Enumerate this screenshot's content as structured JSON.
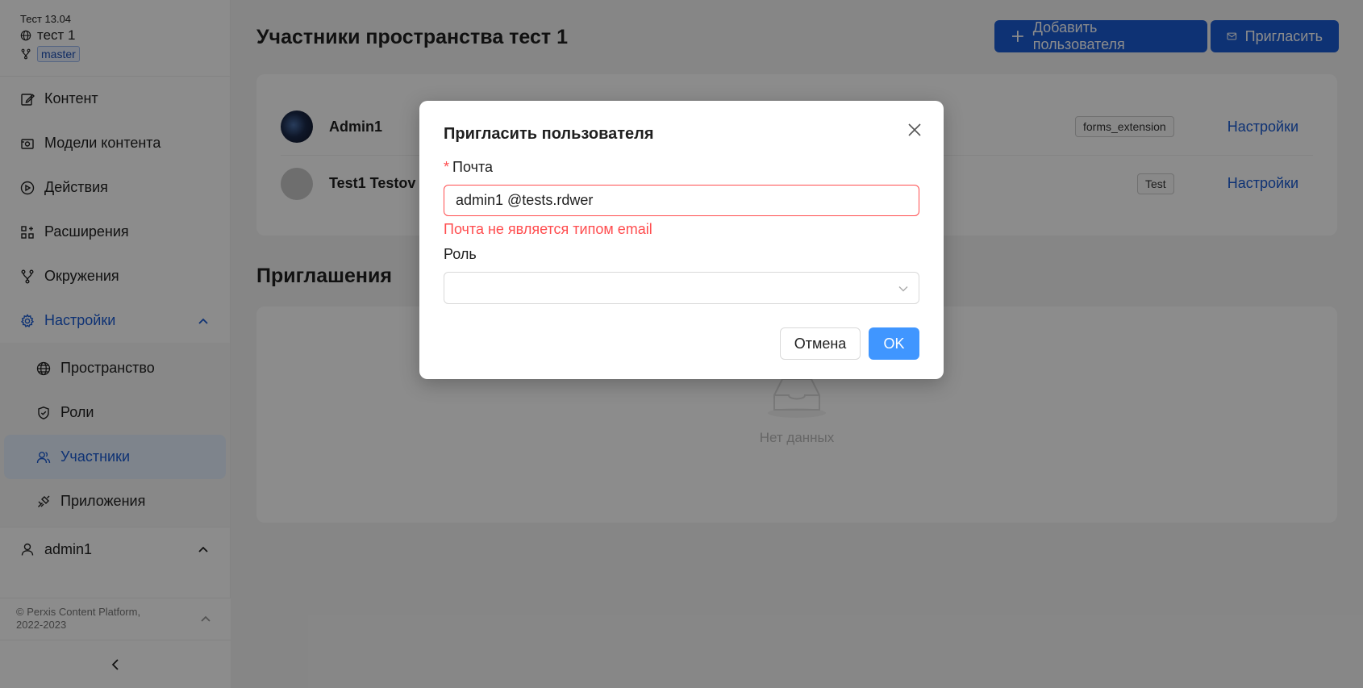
{
  "sidebar": {
    "project_name": "Тест 13.04",
    "space_name": "тест 1",
    "branch": "master",
    "menu": [
      {
        "label": "Контент",
        "icon": "edit-icon"
      },
      {
        "label": "Модели контента",
        "icon": "camera-icon"
      },
      {
        "label": "Действия",
        "icon": "play-circle-icon"
      },
      {
        "label": "Расширения",
        "icon": "apps-icon"
      },
      {
        "label": "Окружения",
        "icon": "branch-icon"
      },
      {
        "label": "Настройки",
        "icon": "gear-icon"
      }
    ],
    "submenu": [
      {
        "label": "Пространство",
        "icon": "globe-icon"
      },
      {
        "label": "Роли",
        "icon": "shield-icon"
      },
      {
        "label": "Участники",
        "icon": "users-icon"
      },
      {
        "label": "Приложения",
        "icon": "plug-icon"
      }
    ],
    "user": "admin1",
    "copyright": "© Perxis Content Platform,\n2022-2023"
  },
  "main": {
    "title": "Участники пространства тест 1",
    "add_user_label": "Добавить пользователя",
    "invite_label": "Пригласить",
    "members": [
      {
        "name": "Admin1",
        "role": "forms_extension",
        "action": "Настройки"
      },
      {
        "name": "Test1 Testov",
        "role": "Test",
        "action": "Настройки"
      }
    ],
    "invites_title": "Приглашения",
    "empty_text": "Нет данных"
  },
  "modal": {
    "title": "Пригласить пользователя",
    "email_label": "Почта",
    "email_required_mark": "*",
    "email_value": "admin1 @tests.rdwer",
    "email_error": "Почта не является типом email",
    "role_label": "Роль",
    "role_value": "",
    "cancel_label": "Отмена",
    "ok_label": "OK"
  },
  "colors": {
    "accent": "#1a5bd4",
    "ok_button": "#4096ff",
    "error": "#ff4d4f"
  }
}
